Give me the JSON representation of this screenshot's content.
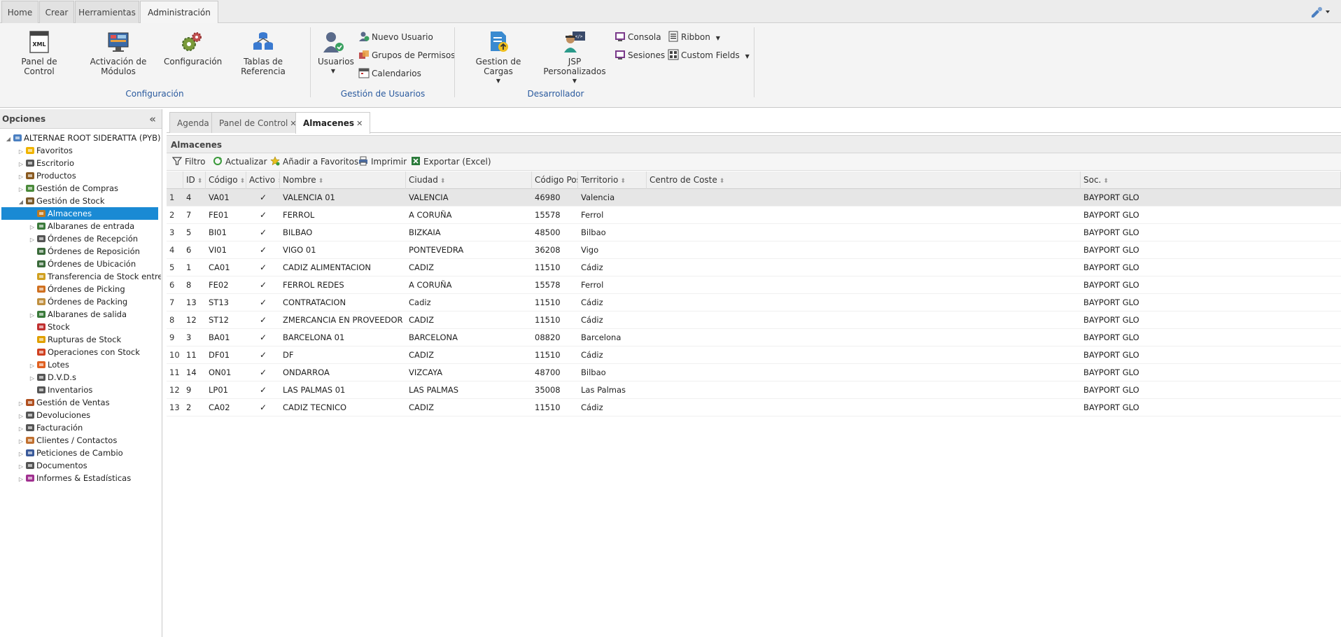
{
  "main_tabs": [
    {
      "label": "Home",
      "active": false
    },
    {
      "label": "Crear",
      "active": false
    },
    {
      "label": "Herramientas",
      "active": false
    },
    {
      "label": "Administración",
      "active": true
    }
  ],
  "ribbon": {
    "configuracion": {
      "label": "Configuración",
      "buttons": [
        {
          "label": "Panel de Control",
          "icon": "xml-document-icon"
        },
        {
          "label": "Activación de Módulos",
          "icon": "modules-monitor-icon"
        },
        {
          "label": "Configuración",
          "icon": "gears-icon"
        },
        {
          "label": "Tablas de Referencia",
          "icon": "database-tables-icon"
        }
      ]
    },
    "usuarios": {
      "label": "Gestión de Usuarios",
      "big_button": {
        "label": "Usuarios",
        "icon": "users-icon"
      },
      "small_buttons": [
        {
          "label": "Nuevo Usuario",
          "icon": "new-user-icon"
        },
        {
          "label": "Grupos de Permisos",
          "icon": "permission-groups-icon"
        },
        {
          "label": "Calendarios",
          "icon": "calendar-icon"
        }
      ]
    },
    "desarrollador": {
      "label": "Desarrollador",
      "big_buttons": [
        {
          "label": "Gestion de Cargas",
          "icon": "upload-file-icon"
        },
        {
          "label": "JSP Personalizados",
          "icon": "developer-icon"
        }
      ],
      "small_buttons": [
        {
          "label": "Consola",
          "icon": "console-icon"
        },
        {
          "label": "Ribbon",
          "icon": "ribbon-icon"
        },
        {
          "label": "Sesiones",
          "icon": "sessions-icon"
        },
        {
          "label": "Custom Fields",
          "icon": "custom-fields-icon"
        }
      ]
    }
  },
  "left_panel": {
    "title": "Opciones",
    "tree": [
      {
        "label": "ALTERNAE ROOT SIDERATTA (PYB)",
        "level": 0,
        "state": "expanded",
        "icon": "root-icon",
        "color": "#4a7fc1"
      },
      {
        "label": "Favoritos",
        "level": 1,
        "state": "collapsed",
        "icon": "star-icon",
        "color": "#f0b400"
      },
      {
        "label": "Escritorio",
        "level": 1,
        "state": "collapsed",
        "icon": "desktop-icon",
        "color": "#555555"
      },
      {
        "label": "Productos",
        "level": 1,
        "state": "collapsed",
        "icon": "products-icon",
        "color": "#8a5a20"
      },
      {
        "label": "Gestión de Compras",
        "level": 1,
        "state": "collapsed",
        "icon": "purchases-icon",
        "color": "#4a8a3a"
      },
      {
        "label": "Gestión de Stock",
        "level": 1,
        "state": "expanded",
        "icon": "stock-management-icon",
        "color": "#7a5a2a"
      },
      {
        "label": "Almacenes",
        "level": 2,
        "state": "leaf",
        "icon": "warehouse-icon",
        "color": "#c07a20",
        "selected": true
      },
      {
        "label": "Albaranes de entrada",
        "level": 2,
        "state": "collapsed",
        "icon": "delivery-in-icon",
        "color": "#3a7a3a"
      },
      {
        "label": "Órdenes de Recepción",
        "level": 2,
        "state": "collapsed",
        "icon": "reception-icon",
        "color": "#555555"
      },
      {
        "label": "Órdenes de Reposición",
        "level": 2,
        "state": "leaf",
        "icon": "replenishment-icon",
        "color": "#3a6a3a"
      },
      {
        "label": "Órdenes de Ubicación",
        "level": 2,
        "state": "leaf",
        "icon": "location-icon",
        "color": "#3a6a3a"
      },
      {
        "label": "Transferencia de Stock entre Almacenes",
        "level": 2,
        "state": "leaf",
        "icon": "transfer-icon",
        "color": "#d0a020"
      },
      {
        "label": "Órdenes de Picking",
        "level": 2,
        "state": "leaf",
        "icon": "picking-icon",
        "color": "#d07020"
      },
      {
        "label": "Órdenes de Packing",
        "level": 2,
        "state": "leaf",
        "icon": "packing-icon",
        "color": "#c09040"
      },
      {
        "label": "Albaranes de salida",
        "level": 2,
        "state": "collapsed",
        "icon": "delivery-out-icon",
        "color": "#3a7a3a"
      },
      {
        "label": "Stock",
        "level": 2,
        "state": "leaf",
        "icon": "stock-icon",
        "color": "#c03030"
      },
      {
        "label": "Rupturas de Stock",
        "level": 2,
        "state": "leaf",
        "icon": "stock-break-icon",
        "color": "#e0a000"
      },
      {
        "label": "Operaciones con Stock",
        "level": 2,
        "state": "leaf",
        "icon": "stock-operations-icon",
        "color": "#d04020"
      },
      {
        "label": "Lotes",
        "level": 2,
        "state": "collapsed",
        "icon": "lots-icon",
        "color": "#e06020"
      },
      {
        "label": "D.V.D.s",
        "level": 2,
        "state": "collapsed",
        "icon": "dvd-icon",
        "color": "#555555"
      },
      {
        "label": "Inventarios",
        "level": 2,
        "state": "leaf",
        "icon": "inventory-icon",
        "color": "#555555"
      },
      {
        "label": "Gestión de Ventas",
        "level": 1,
        "state": "collapsed",
        "icon": "sales-icon",
        "color": "#b05020"
      },
      {
        "label": "Devoluciones",
        "level": 1,
        "state": "collapsed",
        "icon": "returns-icon",
        "color": "#555555"
      },
      {
        "label": "Facturación",
        "level": 1,
        "state": "collapsed",
        "icon": "billing-icon",
        "color": "#555555"
      },
      {
        "label": "Clientes / Contactos",
        "level": 1,
        "state": "collapsed",
        "icon": "clients-icon",
        "color": "#c07030"
      },
      {
        "label": "Peticiones de Cambio",
        "level": 1,
        "state": "collapsed",
        "icon": "change-requests-icon",
        "color": "#3a5a9a"
      },
      {
        "label": "Documentos",
        "level": 1,
        "state": "collapsed",
        "icon": "documents-icon",
        "color": "#555555"
      },
      {
        "label": "Informes & Estadísticas",
        "level": 1,
        "state": "collapsed",
        "icon": "reports-icon",
        "color": "#a03090"
      }
    ]
  },
  "content_tabs": [
    {
      "label": "Agenda",
      "closable": false,
      "active": false
    },
    {
      "label": "Panel de Control",
      "closable": true,
      "active": false
    },
    {
      "label": "Almacenes",
      "closable": true,
      "active": true
    }
  ],
  "panel_title": "Almacenes",
  "toolbar": [
    {
      "label": "Filtro",
      "icon": "filter-icon"
    },
    {
      "label": "Actualizar",
      "icon": "refresh-icon"
    },
    {
      "label": "Añadir a Favoritos",
      "icon": "add-favorite-icon"
    },
    {
      "label": "Imprimir",
      "icon": "print-icon"
    },
    {
      "label": "Exportar (Excel)",
      "icon": "excel-icon"
    }
  ],
  "table": {
    "columns": [
      "",
      "ID",
      "Código",
      "Activo",
      "Nombre",
      "Ciudad",
      "Código Postal",
      "Territorio",
      "Centro de Coste",
      "Soc."
    ],
    "rows": [
      [
        "1",
        "4",
        "VA01",
        "✓",
        "VALENCIA 01",
        "VALENCIA",
        "46980",
        "Valencia",
        "",
        "BAYPORT GLO"
      ],
      [
        "2",
        "7",
        "FE01",
        "✓",
        "FERROL",
        "A CORUÑA",
        "15578",
        "Ferrol",
        "",
        "BAYPORT GLO"
      ],
      [
        "3",
        "5",
        "BI01",
        "✓",
        "BILBAO",
        "BIZKAIA",
        "48500",
        "Bilbao",
        "",
        "BAYPORT GLO"
      ],
      [
        "4",
        "6",
        "VI01",
        "✓",
        "VIGO 01",
        "PONTEVEDRA",
        "36208",
        "Vigo",
        "",
        "BAYPORT GLO"
      ],
      [
        "5",
        "1",
        "CA01",
        "✓",
        "CADIZ ALIMENTACION",
        "CADIZ",
        "11510",
        "Cádiz",
        "",
        "BAYPORT GLO"
      ],
      [
        "6",
        "8",
        "FE02",
        "✓",
        "FERROL REDES",
        "A CORUÑA",
        "15578",
        "Ferrol",
        "",
        "BAYPORT GLO"
      ],
      [
        "7",
        "13",
        "ST13",
        "✓",
        "CONTRATACION",
        "Cadiz",
        "11510",
        "Cádiz",
        "",
        "BAYPORT GLO"
      ],
      [
        "8",
        "12",
        "ST12",
        "✓",
        "ZMERCANCIA EN PROVEEDOR",
        "CADIZ",
        "11510",
        "Cádiz",
        "",
        "BAYPORT GLO"
      ],
      [
        "9",
        "3",
        "BA01",
        "✓",
        "BARCELONA 01",
        "BARCELONA",
        "08820",
        "Barcelona",
        "",
        "BAYPORT GLO"
      ],
      [
        "10",
        "11",
        "DF01",
        "✓",
        "DF",
        "CADIZ",
        "11510",
        "Cádiz",
        "",
        "BAYPORT GLO"
      ],
      [
        "11",
        "14",
        "ON01",
        "✓",
        "ONDARROA",
        "VIZCAYA",
        "48700",
        "Bilbao",
        "",
        "BAYPORT GLO"
      ],
      [
        "12",
        "9",
        "LP01",
        "✓",
        "LAS PALMAS 01",
        "LAS PALMAS",
        "35008",
        "Las Palmas",
        "",
        "BAYPORT GLO"
      ],
      [
        "13",
        "2",
        "CA02",
        "✓",
        "CADIZ TECNICO",
        "CADIZ",
        "11510",
        "Cádiz",
        "",
        "BAYPORT GLO"
      ]
    ]
  },
  "colors": {
    "selection": "#1a8ad4",
    "group_label": "#2a5a9e"
  }
}
